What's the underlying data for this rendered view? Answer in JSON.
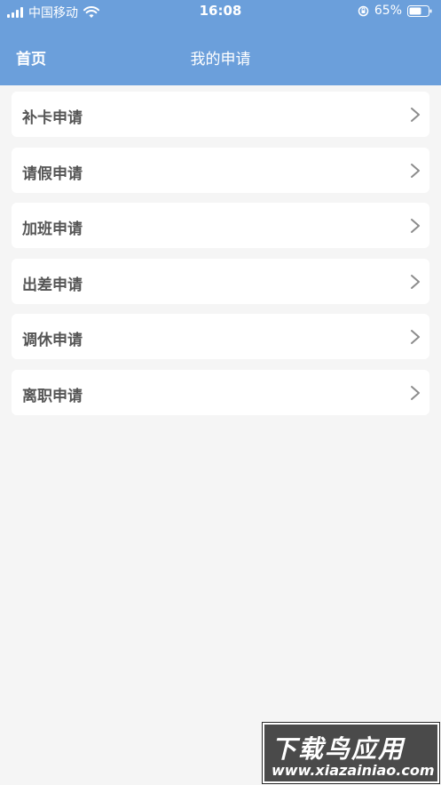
{
  "status_bar": {
    "carrier": "中国移动",
    "time": "16:08",
    "battery_percent": "65%",
    "battery_level": 0.65
  },
  "nav": {
    "back_label": "首页",
    "title": "我的申请"
  },
  "menu": {
    "items": [
      {
        "label": "补卡申请"
      },
      {
        "label": "请假申请"
      },
      {
        "label": "加班申请"
      },
      {
        "label": "出差申请"
      },
      {
        "label": "调休申请"
      },
      {
        "label": "离职申请"
      }
    ]
  },
  "watermark": {
    "title": "下载鸟应用",
    "url": "www.xiazainiao.com"
  },
  "colors": {
    "header_bg": "#6b9fdb",
    "page_bg": "#f5f5f5",
    "item_bg": "#ffffff",
    "item_text": "#555555"
  }
}
